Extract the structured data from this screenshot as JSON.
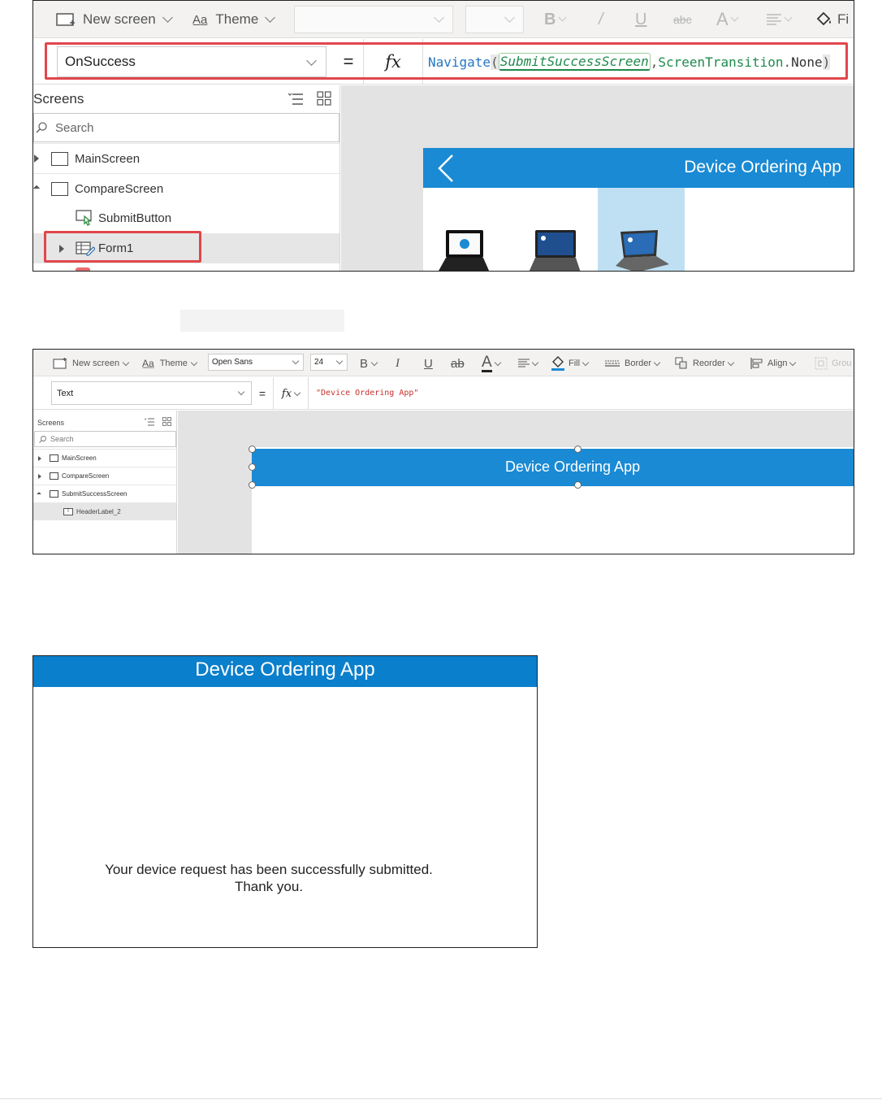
{
  "panel1": {
    "toolbar": {
      "new_screen": "New screen",
      "theme": "Theme",
      "fill_partial": "Fi"
    },
    "formula": {
      "property": "OnSuccess",
      "equals": "=",
      "fx": "fx",
      "navigate": "Navigate",
      "paren_open": "(",
      "arg_screen": "SubmitSuccessScreen",
      "comma": ",",
      "arg_transition": "ScreenTransition",
      "dot": ".",
      "arg_none": "None",
      "paren_close": ")"
    },
    "sidebar": {
      "title": "Screens",
      "search_placeholder": "Search",
      "items": [
        {
          "label": "MainScreen"
        },
        {
          "label": "CompareScreen"
        },
        {
          "label": "SubmitButton"
        },
        {
          "label": "Form1"
        }
      ]
    },
    "app_header": "Device Ordering App"
  },
  "panel2": {
    "toolbar": {
      "new_screen": "New screen",
      "theme": "Theme",
      "font": "Open Sans",
      "size": "24",
      "bold": "B",
      "italic": "I",
      "underline": "U",
      "strike": "ab",
      "font_color": "A",
      "fill": "Fill",
      "border": "Border",
      "reorder": "Reorder",
      "align": "Align",
      "group_partial": "Grou"
    },
    "formula": {
      "property": "Text",
      "equals": "=",
      "fx": "fx",
      "value": "\"Device Ordering App\""
    },
    "sidebar": {
      "title": "Screens",
      "search_placeholder": "Search",
      "items": [
        {
          "label": "MainScreen"
        },
        {
          "label": "CompareScreen"
        },
        {
          "label": "SubmitSuccessScreen"
        },
        {
          "label": "HeaderLabel_2"
        }
      ]
    },
    "app_header": "Device Ordering App"
  },
  "panel3": {
    "app_header": "Device Ordering App",
    "message_line1": "Your device request has been successfully submitted.",
    "message_line2": "Thank you."
  },
  "colors": {
    "header_blue": "#1a8ad4",
    "highlight_red": "#e0474c",
    "formula_string_red": "#c7312c",
    "keyword_blue": "#2576c2",
    "param_green": "#1f8a4c"
  }
}
